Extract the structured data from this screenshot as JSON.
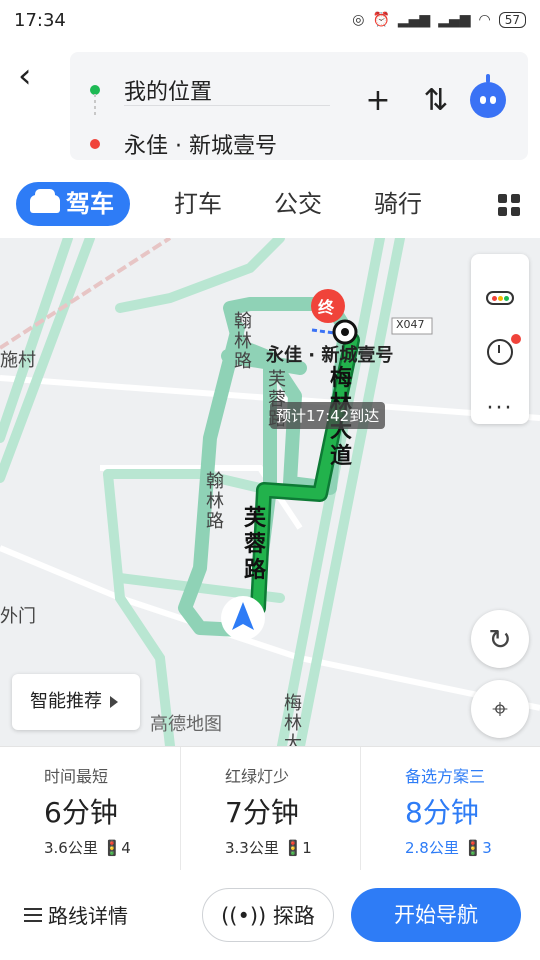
{
  "status_bar": {
    "time": "17:34",
    "battery": "57"
  },
  "header": {
    "origin": "我的位置",
    "destination": "永佳 · 新城壹号",
    "add_icon": "+",
    "swap_icon": "⇅"
  },
  "tabs": [
    {
      "label": "驾车",
      "active": true
    },
    {
      "label": "打车"
    },
    {
      "label": "公交"
    },
    {
      "label": "骑行"
    }
  ],
  "map": {
    "labels": {
      "hanlin_1": "翰林路",
      "hanlin_2": "翰林路",
      "furong_small": "芙蓉路",
      "furong_route": "芙蓉路",
      "meilin_route": "梅林大道",
      "meilin_bottom": "梅林大",
      "village": "施村",
      "gate": "外门",
      "road_code": "X047",
      "dest_name": "永佳 · 新城壹号",
      "end_marker": "终",
      "eta": "预计17:42到达"
    },
    "smart_recommend": "智能推荐",
    "watermark": "高德地图"
  },
  "plans": [
    {
      "title": "时间最短",
      "time": "6分钟",
      "info": "3.6公里 🚦4",
      "selected": false
    },
    {
      "title": "红绿灯少",
      "time": "7分钟",
      "info": "3.3公里 🚦1",
      "selected": false
    },
    {
      "title": "备选方案三",
      "time": "8分钟",
      "info": "2.8公里 🚦3",
      "selected": true
    }
  ],
  "bottom": {
    "detail": "路线详情",
    "explore": "探路",
    "start": "开始导航"
  },
  "colors": {
    "accent": "#2e7cf6",
    "route": "#1aa64a",
    "road": "#a8e0c8"
  }
}
